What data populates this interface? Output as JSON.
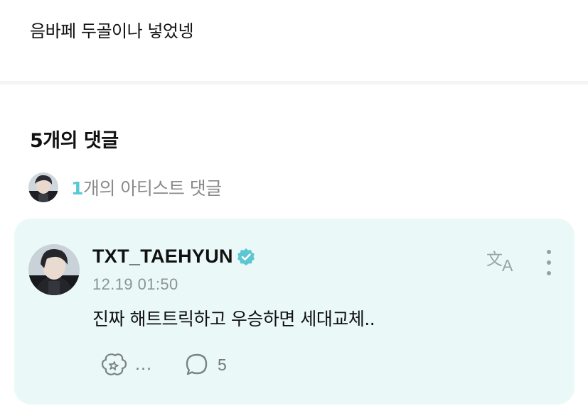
{
  "post": {
    "text": "음바페 두골이나 넣었넹"
  },
  "comments": {
    "count_num": "5",
    "count_suffix": "개의 댓글",
    "artist_count_num": "1",
    "artist_count_suffix": "개의 아티스트 댓글"
  },
  "comment": {
    "username": "TXT_TAEHYUN",
    "timestamp": "12.19 01:50",
    "body": "진짜 해트트릭하고 우승하면 세대교체..",
    "reactions_label": "...",
    "replies_count": "5",
    "translate_icon": "translate-icon",
    "more_icon": "more-vertical-icon",
    "verified_icon": "verified-badge-icon"
  },
  "colors": {
    "accent": "#58c8d4",
    "card_bg": "#eaf9f8",
    "muted": "#8a8a8a"
  }
}
